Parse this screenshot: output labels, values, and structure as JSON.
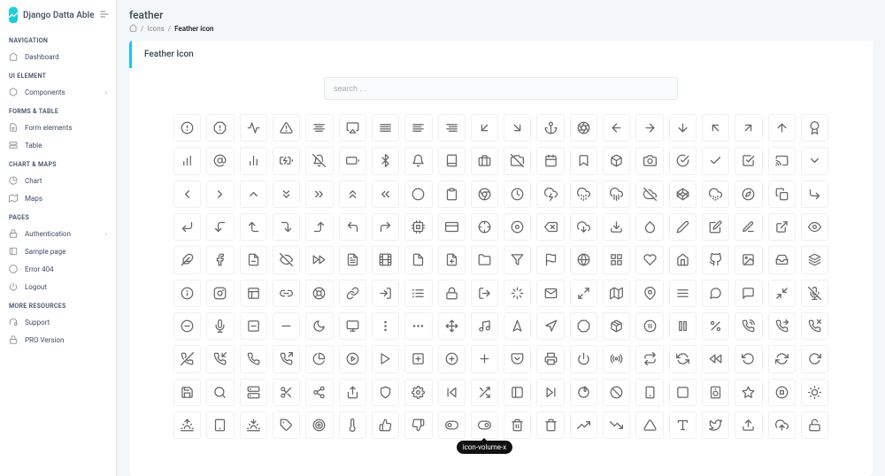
{
  "brand": "Django Datta Able",
  "header": {
    "title": "feather",
    "breadcrumb": [
      "Icons",
      "Feather icon"
    ]
  },
  "card_title": "Feather Icon",
  "search_placeholder": "search . .",
  "sidebar": [
    {
      "section": "NAVIGATION",
      "items": [
        {
          "icon": "home",
          "label": "Dashboard"
        }
      ]
    },
    {
      "section": "UI ELEMENT",
      "items": [
        {
          "icon": "box",
          "label": "Components",
          "chevron": true
        }
      ]
    },
    {
      "section": "FORMS & TABLE",
      "items": [
        {
          "icon": "file-text",
          "label": "Form elements"
        },
        {
          "icon": "server",
          "label": "Table"
        }
      ]
    },
    {
      "section": "CHART & MAPS",
      "items": [
        {
          "icon": "pie-chart",
          "label": "Chart"
        },
        {
          "icon": "map",
          "label": "Maps"
        }
      ]
    },
    {
      "section": "PAGES",
      "items": [
        {
          "icon": "lock",
          "label": "Authentication",
          "chevron": true
        },
        {
          "icon": "sidebar",
          "label": "Sample page"
        },
        {
          "icon": "alert",
          "label": "Error 404"
        },
        {
          "icon": "power",
          "label": "Logout"
        }
      ]
    },
    {
      "section": "MORE RESOURCES",
      "items": [
        {
          "icon": "headphones",
          "label": "Support"
        },
        {
          "icon": "lock",
          "label": "PRO Version"
        }
      ]
    }
  ],
  "tooltip_text": "icon-volume-x",
  "tooltip_index": 189,
  "icons": [
    "alert-circle",
    "alert-octagon",
    "activity",
    "alert-triangle",
    "align-center",
    "airplay",
    "align-justify",
    "align-left",
    "align-right",
    "arrow-down-left",
    "arrow-down-right",
    "anchor",
    "aperture",
    "arrow-left",
    "arrow-right",
    "arrow-down",
    "arrow-up-left",
    "arrow-up-right",
    "arrow-up",
    "award",
    "bar-chart",
    "at-sign",
    "bar-chart-2",
    "battery-charging",
    "bell-off",
    "battery",
    "bluetooth",
    "bell",
    "book",
    "briefcase",
    "camera-off",
    "calendar",
    "bookmark",
    "box",
    "camera",
    "check-circle",
    "check",
    "check-square",
    "cast",
    "chevron-down",
    "chevron-left",
    "chevron-right",
    "chevron-up",
    "chevrons-down",
    "chevrons-right",
    "chevrons-up",
    "chevrons-left",
    "circle",
    "clipboard",
    "chrome",
    "clock",
    "cloud-lightning",
    "cloud-drizzle",
    "cloud-rain",
    "cloud-off",
    "codepen",
    "cloud-snow",
    "compass",
    "copy",
    "corner-down-right",
    "corner-down-left",
    "corner-left-down",
    "corner-left-up",
    "corner-right-down",
    "corner-right-up",
    "corner-up-left",
    "corner-up-right",
    "cpu",
    "credit-card",
    "crosshair",
    "disc",
    "delete",
    "download-cloud",
    "download",
    "droplet",
    "edit-2",
    "edit",
    "edit-1",
    "external-link",
    "eye",
    "feather",
    "facebook",
    "file-minus",
    "eye-off",
    "fast-forward",
    "file-text",
    "film",
    "file",
    "file-plus",
    "folder",
    "filter",
    "flag",
    "globe",
    "grid",
    "heart",
    "home",
    "github",
    "image",
    "inbox",
    "layers",
    "info",
    "instagram",
    "layout",
    "link-2",
    "life-buoy",
    "link",
    "log-in",
    "list",
    "lock",
    "log-out",
    "loader",
    "mail",
    "maximize-2",
    "map",
    "map-pin",
    "menu",
    "message-circle",
    "message-square",
    "minimize-2",
    "mic-off",
    "minus-circle",
    "mic",
    "minus-square",
    "minus",
    "moon",
    "monitor",
    "more-vertical",
    "more-horizontal",
    "move",
    "music",
    "navigation-2",
    "navigation",
    "octagon",
    "package",
    "pause-circle",
    "pause",
    "percent",
    "phone-call",
    "phone-forwarded",
    "phone-missed",
    "phone-off",
    "phone-incoming",
    "phone",
    "phone-outgoing",
    "pie-chart",
    "play-circle",
    "play",
    "plus-square",
    "plus-circle",
    "plus",
    "pocket",
    "printer",
    "power",
    "radio",
    "repeat",
    "refresh-ccw",
    "rewind",
    "rotate-ccw",
    "refresh-cw",
    "rotate-cw",
    "save",
    "search",
    "server",
    "scissors",
    "share-2",
    "share",
    "shield",
    "settings",
    "skip-back",
    "shuffle",
    "sidebar",
    "skip-forward",
    "slack",
    "slash",
    "smartphone",
    "square",
    "speaker",
    "star",
    "stop-circle",
    "sun",
    "sunrise",
    "tablet",
    "sunset",
    "tag",
    "target",
    "thermometer",
    "thumbs-up",
    "thumbs-down",
    "toggle-left",
    "toggle-right",
    "trash-2",
    "trash",
    "trending-up",
    "trending-down",
    "triangle",
    "type",
    "twitter",
    "upload",
    "upload-cloud",
    "unlock"
  ]
}
